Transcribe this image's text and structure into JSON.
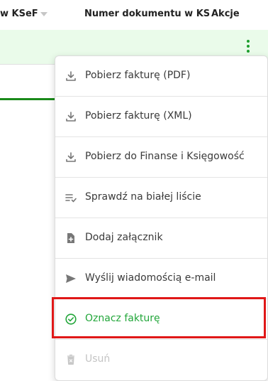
{
  "table_header": {
    "col_ksef": "w KSeF",
    "col_numer": "Numer dokumentu w KS",
    "col_akcje": "Akcje"
  },
  "row": {
    "kebab_icon": "more-vert-icon",
    "accent_color": "#1e9e2e",
    "row_bg": "#eafbea"
  },
  "menu": {
    "items": [
      {
        "label": "Pobierz fakturę (PDF)",
        "icon": "download-icon"
      },
      {
        "label": "Pobierz fakturę (XML)",
        "icon": "download-icon"
      },
      {
        "label": "Pobierz do Finanse i Księgowość",
        "icon": "download-icon"
      },
      {
        "label": "Sprawdź na białej liście",
        "icon": "list-check-icon"
      },
      {
        "label": "Dodaj załącznik",
        "icon": "file-add-icon"
      },
      {
        "label": "Wyślij wiadomością e-mail",
        "icon": "send-icon"
      },
      {
        "label": "Oznacz fakturę",
        "icon": "check-circle-icon",
        "state": "success"
      },
      {
        "label": "Usuń",
        "icon": "trash-icon",
        "state": "disabled"
      }
    ]
  },
  "colors": {
    "success": "#22a63a",
    "disabled": "#c4c4c4",
    "highlight_border": "#e01818"
  }
}
